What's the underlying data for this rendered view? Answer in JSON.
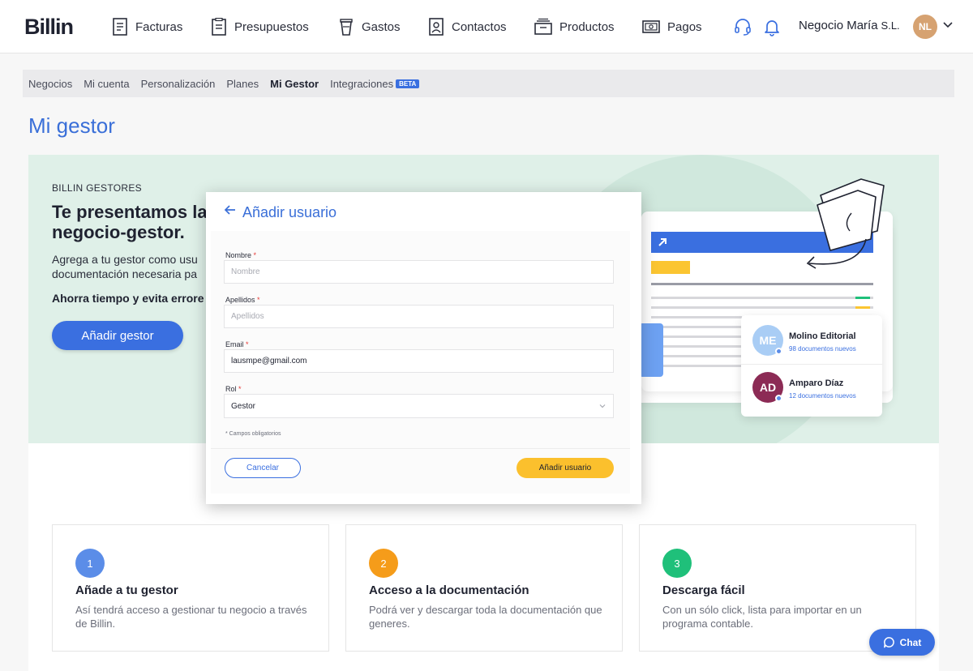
{
  "brand": {
    "logo": "Billin"
  },
  "nav": {
    "items": [
      {
        "label": "Facturas",
        "icon": "invoice-icon"
      },
      {
        "label": "Presupuestos",
        "icon": "quote-icon"
      },
      {
        "label": "Gastos",
        "icon": "expenses-icon"
      },
      {
        "label": "Contactos",
        "icon": "contacts-icon"
      },
      {
        "label": "Productos",
        "icon": "products-icon"
      },
      {
        "label": "Pagos",
        "icon": "payments-icon"
      }
    ],
    "company_name": "Negocio María",
    "company_suffix": "S.L.",
    "avatar_initials": "NL"
  },
  "subnav": {
    "items": [
      "Negocios",
      "Mi cuenta",
      "Personalización",
      "Planes",
      "Mi Gestor",
      "Integraciones"
    ],
    "active": "Mi Gestor",
    "beta_badge": "BETA"
  },
  "page": {
    "title": "Mi gestor"
  },
  "hero": {
    "eyebrow": "BILLIN GESTORES",
    "title": "Te presentamos la negocio-gestor.",
    "title_line1": "Te presentamos la",
    "title_line2": "negocio-gestor.",
    "desc_line1": "Agrega a tu gestor como usu",
    "desc_line2": "documentación necesaria pa",
    "save_text": "Ahorra tiempo y evita errore",
    "button": "Añadir gestor"
  },
  "illustration": {
    "users": [
      {
        "initials": "ME",
        "name": "Molino Editorial",
        "sub": "98 documentos nuevos",
        "color": "#a9cdf5"
      },
      {
        "initials": "AD",
        "name": "Amparo Díaz",
        "sub": "12 documentos nuevos",
        "color": "#8c2b55"
      }
    ]
  },
  "modal": {
    "title": "Añadir usuario",
    "fields": {
      "nombre": {
        "label": "Nombre",
        "placeholder": "Nombre",
        "value": ""
      },
      "apellidos": {
        "label": "Apellidos",
        "placeholder": "Apellidos",
        "value": ""
      },
      "email": {
        "label": "Email",
        "placeholder": "",
        "value": "lausmpe@gmail.com"
      },
      "rol": {
        "label": "Rol",
        "value": "Gestor"
      }
    },
    "required_mark": "*",
    "note": "* Campos obligatorios",
    "cancel": "Cancelar",
    "submit": "Añadir usuario"
  },
  "steps": [
    {
      "number": "1",
      "title": "Añade a tu gestor",
      "desc": "Así tendrá acceso a gestionar tu negocio a través de Billin.",
      "color": "#5b8de8"
    },
    {
      "number": "2",
      "title": "Acceso a la documentación",
      "desc": "Podrá ver y descargar toda la documentación que generes.",
      "color": "#f59c1a"
    },
    {
      "number": "3",
      "title": "Descarga fácil",
      "desc": "Con un sólo click, lista para importar en un programa contable.",
      "color": "#1fc07a"
    }
  ],
  "chat": {
    "label": "Chat"
  },
  "colors": {
    "accent": "#3a6fe0",
    "hero_bg": "#dff0e8",
    "submit": "#fbc02d"
  }
}
